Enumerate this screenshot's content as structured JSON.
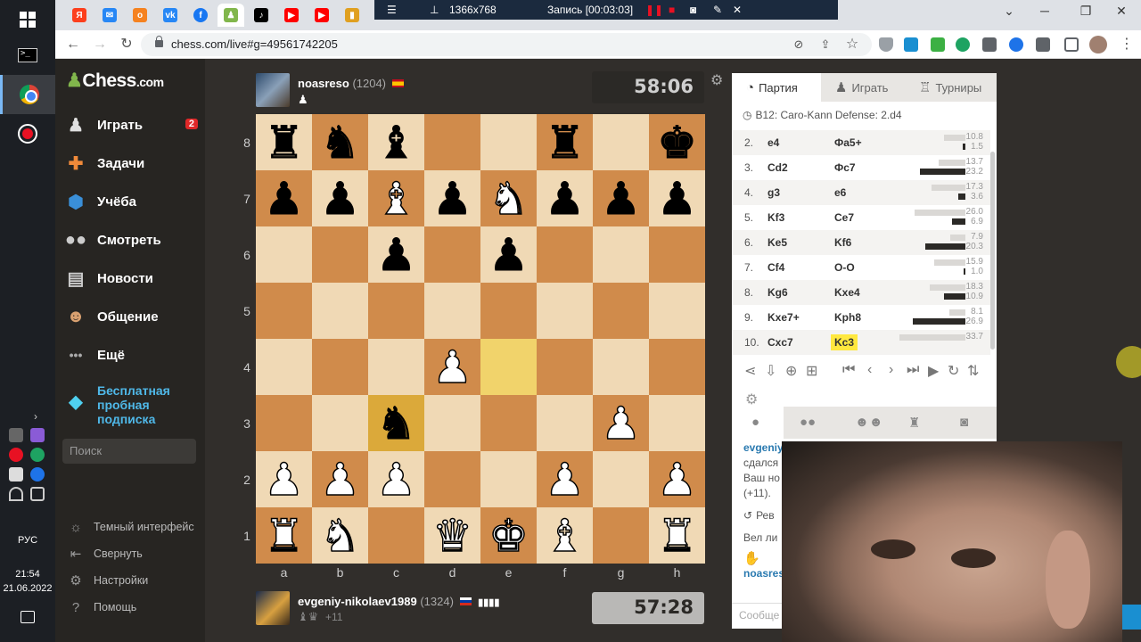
{
  "taskbar": {
    "language": "РУС",
    "time": "21:54",
    "date": "21.06.2022"
  },
  "browser": {
    "recording": {
      "resolution": "1366x768",
      "status": "Запись [00:03:03]"
    },
    "url": "chess.com/live#g=49561742205"
  },
  "sidebar": {
    "logo_main": "Chess",
    "logo_suffix": ".com",
    "nav": [
      {
        "label": "Играть",
        "badge": "2",
        "icon": "pawn-icon"
      },
      {
        "label": "Задачи",
        "icon": "puzzle-icon"
      },
      {
        "label": "Учёба",
        "icon": "graduation-icon"
      },
      {
        "label": "Смотреть",
        "icon": "binoculars-icon"
      },
      {
        "label": "Новости",
        "icon": "newspaper-icon"
      },
      {
        "label": "Общение",
        "icon": "people-icon"
      },
      {
        "label": "Ещё",
        "icon": "more-icon"
      }
    ],
    "trial_line1": "Бесплатная",
    "trial_line2": "пробная",
    "trial_line3": "подписка",
    "search_placeholder": "Поиск",
    "bottom": [
      {
        "label": "Темный интерфейс",
        "icon": "sun-icon"
      },
      {
        "label": "Свернуть",
        "icon": "collapse-icon"
      },
      {
        "label": "Настройки",
        "icon": "gear-icon"
      },
      {
        "label": "Помощь",
        "icon": "help-icon"
      }
    ]
  },
  "game": {
    "top_player": {
      "name": "noasreso",
      "rating": "(1204)",
      "flag": "spain-flag-icon"
    },
    "bottom_player": {
      "name": "evgeniy-nikolaev1989",
      "rating": "(1324)",
      "captured_advantage": "+11",
      "flag": "russia-flag-icon"
    },
    "top_clock": "58:06",
    "bottom_clock": "57:28",
    "ranks": [
      "8",
      "7",
      "6",
      "5",
      "4",
      "3",
      "2",
      "1"
    ],
    "files": [
      "a",
      "b",
      "c",
      "d",
      "e",
      "f",
      "g",
      "h"
    ],
    "board": [
      [
        "bR",
        "bN",
        "bB",
        "",
        "",
        "bR",
        "",
        "bK"
      ],
      [
        "bP",
        "bP",
        "wB",
        "bP",
        "wN",
        "bP",
        "bP",
        "bP"
      ],
      [
        "",
        "",
        "bP",
        "",
        "bP",
        "",
        "",
        ""
      ],
      [
        "",
        "",
        "",
        "",
        "",
        "",
        "",
        ""
      ],
      [
        "",
        "",
        "",
        "wP",
        "",
        "",
        "",
        ""
      ],
      [
        "",
        "",
        "bN",
        "",
        "",
        "",
        "wP",
        ""
      ],
      [
        "wP",
        "wP",
        "wP",
        "",
        "",
        "wP",
        "",
        "wP"
      ],
      [
        "wR",
        "wN",
        "",
        "wQ",
        "wK",
        "wB",
        "",
        "wR"
      ]
    ],
    "highlight_squares": [
      "e4",
      "c3"
    ]
  },
  "panel": {
    "tabs": [
      "Партия",
      "Играть",
      "Турниры"
    ],
    "opening": "B12: Caro-Kann Defense: 2.d4",
    "moves": [
      {
        "num": "2.",
        "white": "e4",
        "black": "Фа5+",
        "t_white": "10.8",
        "t_black": "1.5"
      },
      {
        "num": "3.",
        "white": "Cd2",
        "black": "Фс7",
        "t_white": "13.7",
        "t_black": "23.2"
      },
      {
        "num": "4.",
        "white": "g3",
        "black": "e6",
        "t_white": "17.3",
        "t_black": "3.6"
      },
      {
        "num": "5.",
        "white": "Kf3",
        "black": "Ce7",
        "t_white": "26.0",
        "t_black": "6.9"
      },
      {
        "num": "6.",
        "white": "Ke5",
        "black": "Kf6",
        "t_white": "7.9",
        "t_black": "20.3"
      },
      {
        "num": "7.",
        "white": "Cf4",
        "black": "O-O",
        "t_white": "15.9",
        "t_black": "1.0"
      },
      {
        "num": "8.",
        "white": "Kg6",
        "black": "Kxe4",
        "t_white": "18.3",
        "t_black": "10.9"
      },
      {
        "num": "9.",
        "white": "Kxe7+",
        "black": "Kph8",
        "t_white": "8.1",
        "t_black": "26.9"
      },
      {
        "num": "10.",
        "white": "Cxc7",
        "black": "Kc3",
        "t_white": "33.7",
        "t_black": ""
      }
    ],
    "chat": {
      "user1": "evgeniy",
      "line1": "сдался",
      "line2": "Ваш но",
      "line3": "(+11).",
      "rematch": "Рев",
      "line4": "Вел ли",
      "user2": "noasres",
      "input_placeholder": "Сообще"
    }
  },
  "colors": {
    "accent": "#81b64c",
    "board_light": "#f0d9b5",
    "board_dark": "#d08b4b",
    "highlight": "#f1d36b"
  }
}
